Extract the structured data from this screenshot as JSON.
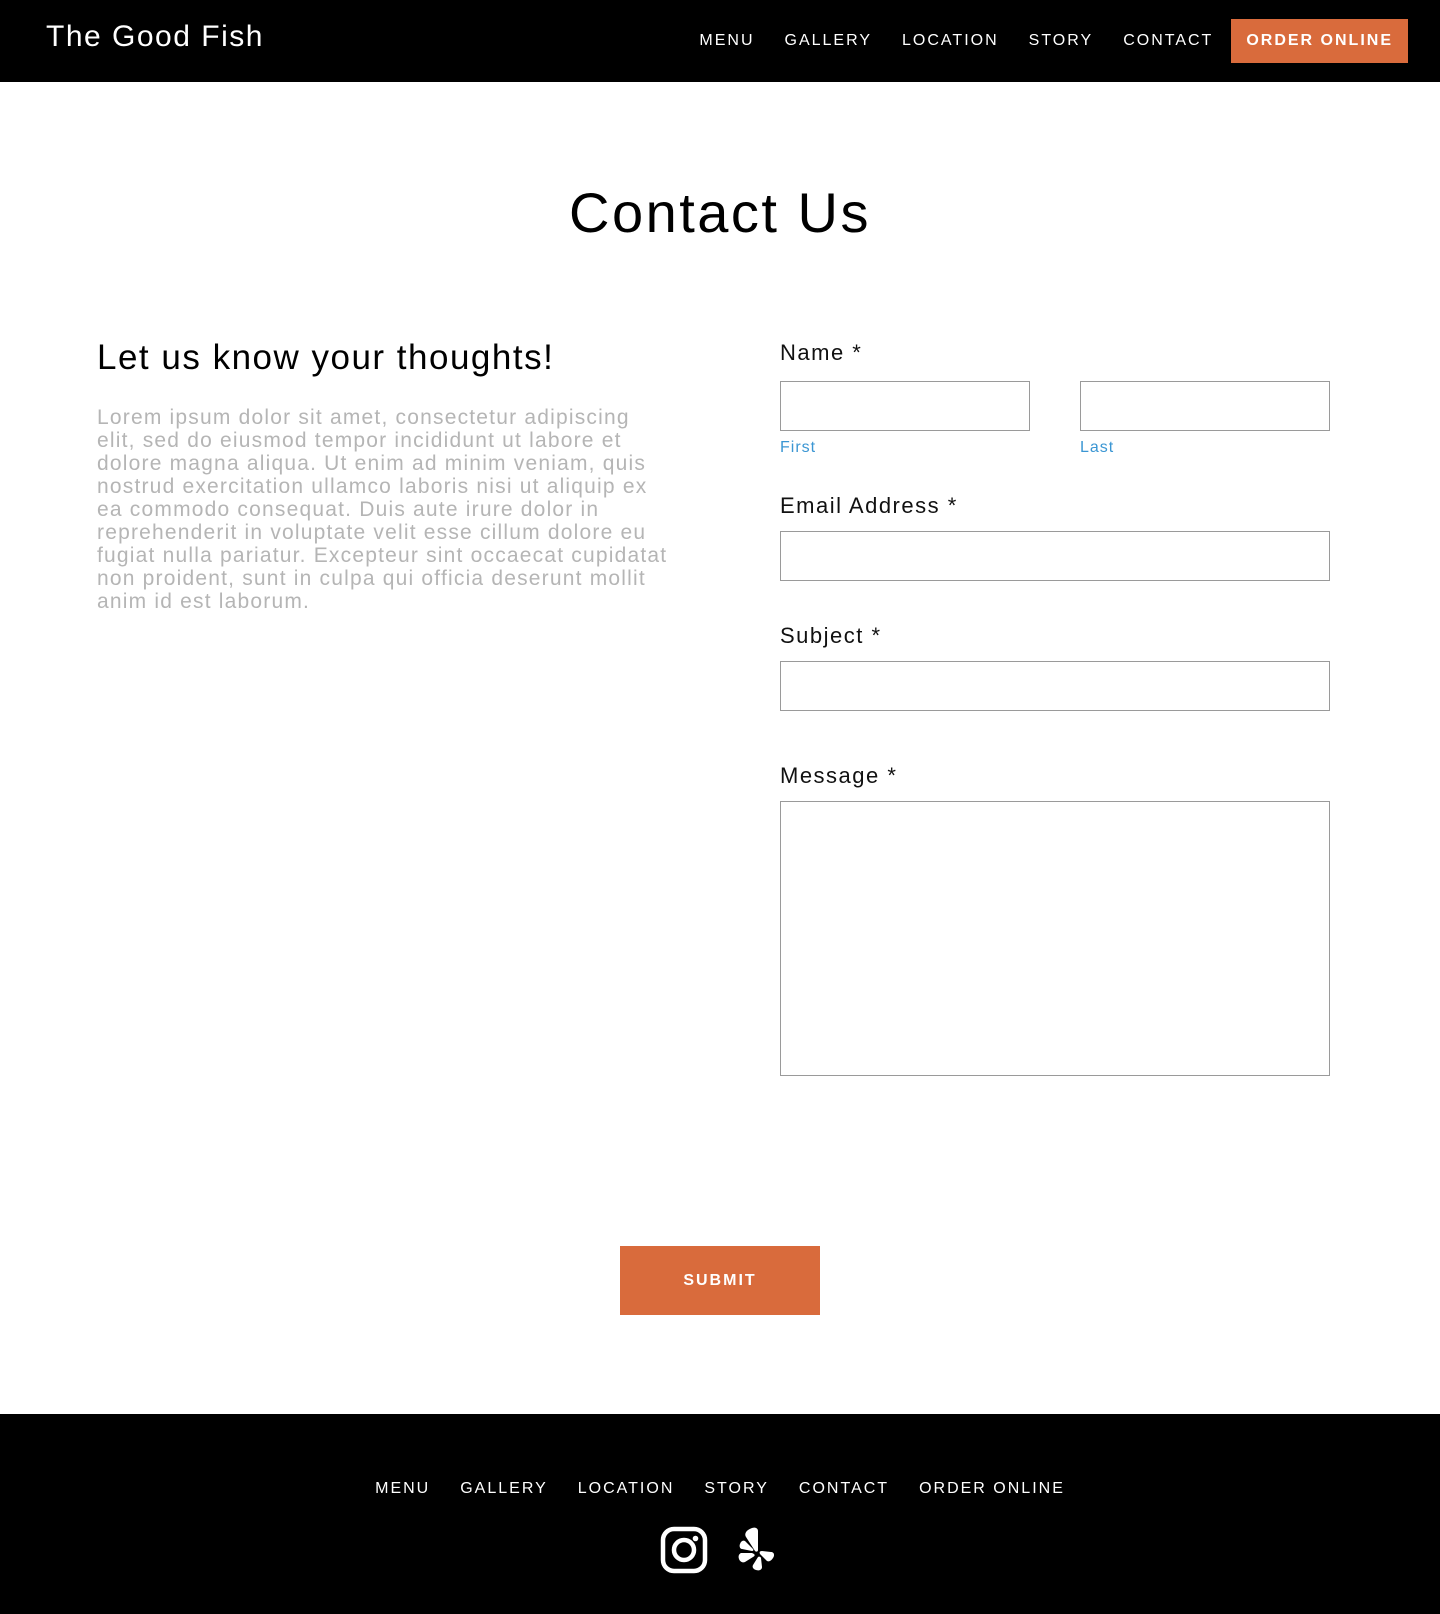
{
  "header": {
    "brand": "The Good Fish",
    "nav": [
      "MENU",
      "GALLERY",
      "LOCATION",
      "STORY",
      "CONTACT"
    ],
    "order_label": "ORDER ONLINE"
  },
  "main": {
    "title": "Contact Us",
    "subhead": "Let us know your thoughts!",
    "body_text": "Lorem ipsum dolor sit amet, consectetur adipiscing elit, sed do eiusmod tempor incididunt ut labore et dolore magna aliqua. Ut enim ad minim veniam, quis nostrud exercitation ullamco laboris nisi ut aliquip ex ea commodo consequat. Duis aute irure dolor in reprehenderit in voluptate velit esse cillum dolore eu fugiat nulla pariatur. Excepteur sint occaecat cupidatat non proident, sunt in culpa qui officia deserunt mollit anim id est laborum."
  },
  "form": {
    "name_label": "Name *",
    "first_label": "First",
    "last_label": "Last",
    "first_value": "",
    "last_value": "",
    "email_label": "Email Address *",
    "email_value": "",
    "subject_label": "Subject *",
    "subject_value": "",
    "message_label": "Message *",
    "message_value": "",
    "submit_label": "SUBMIT"
  },
  "footer": {
    "nav": [
      "MENU",
      "GALLERY",
      "LOCATION",
      "STORY",
      "CONTACT",
      "ORDER ONLINE"
    ],
    "social": [
      "instagram-icon",
      "yelp-icon"
    ]
  },
  "colors": {
    "accent": "#d96b3c",
    "header_bg": "#000000",
    "sublabel": "#3b96d3",
    "body_text": "#b5b5b5"
  }
}
